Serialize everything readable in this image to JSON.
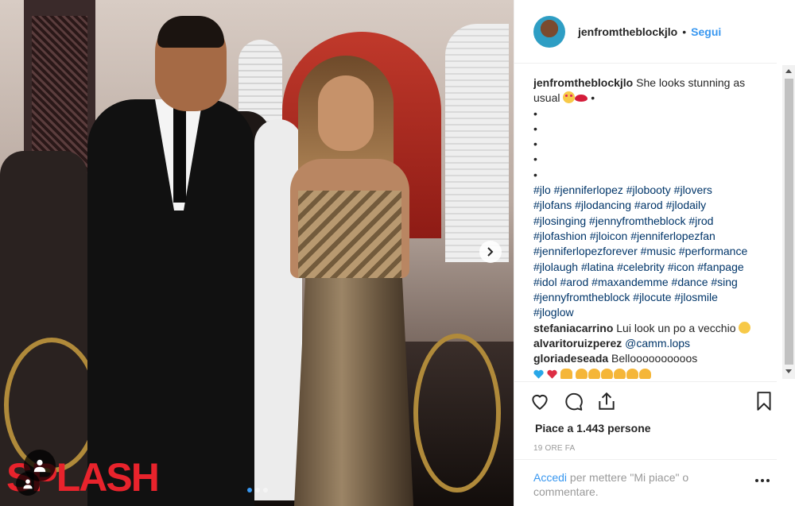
{
  "post": {
    "image_watermark": "SPLASH",
    "carousel": {
      "slides": 3,
      "active": 1
    }
  },
  "header": {
    "username": "jenfromtheblockjlo",
    "separator": "•",
    "follow_label": "Segui"
  },
  "caption": {
    "username": "jenfromtheblockjlo",
    "text": "She looks stunning as",
    "text_line2": "usual",
    "bullets": [
      "•",
      "•",
      "•",
      "•",
      "•",
      "•"
    ],
    "hashtag_lines": [
      "#jlo #jenniferlopez #jlobooty #jlovers",
      "#jlofans #jlodancing #arod #jlodaily",
      "#jlosinging #jennyfromtheblock #jrod",
      "#jlofashion #jloicon #jenniferlopezfan",
      "#jenniferlopezforever #music #performance",
      "#jlolaugh #latina #celebrity #icon #fanpage",
      "#idol #arod #maxandemme #dance #sing",
      "#jennyfromtheblock #jlocute #jlosmile",
      "#jloglow"
    ]
  },
  "comments": [
    {
      "username": "stefaniacarrino",
      "text": "Lui look un po a vecchio"
    },
    {
      "username": "alvaritoruizperez",
      "text": "@camm.lops"
    },
    {
      "username": "gloriadeseada",
      "text": "Belloooooooooos"
    }
  ],
  "likes_text": "Piace a 1.443 persone",
  "time_ago": "19 ORE FA",
  "login": {
    "link": "Accedi",
    "text": "per mettere \"Mi piace\" o commentare."
  },
  "icons": {
    "like": "heart-icon",
    "comment": "comment-icon",
    "share": "share-icon",
    "save": "bookmark-icon",
    "next": "chevron-right-icon",
    "options": "more-icon"
  },
  "colors": {
    "link_blue": "#3897f0",
    "hashtag": "#003569",
    "watermark_red": "#e8232c",
    "muted": "#999999"
  }
}
